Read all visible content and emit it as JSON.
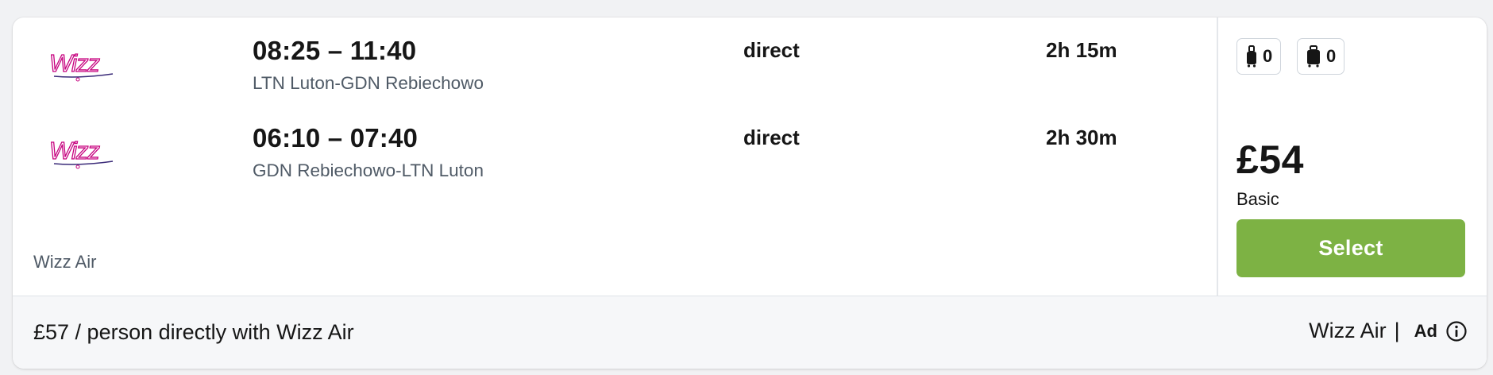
{
  "flights": [
    {
      "airline_logo_text": "Wizz",
      "times": "08:25 – 11:40",
      "route": "LTN Luton-GDN Rebiechowo",
      "stops": "direct",
      "duration": "2h 15m"
    },
    {
      "airline_logo_text": "Wizz",
      "times": "06:10 – 07:40",
      "route": "GDN Rebiechowo-LTN Luton",
      "stops": "direct",
      "duration": "2h 30m"
    }
  ],
  "airline_name": "Wizz Air",
  "baggage": {
    "cabin_bag_count": "0",
    "checked_bag_count": "0",
    "cabin_bag_icon": "cabin-bag-icon",
    "checked_bag_icon": "checked-bag-icon"
  },
  "price": {
    "amount": "£54",
    "fare_type": "Basic",
    "select_label": "Select"
  },
  "footer": {
    "offer_text": "£57 / person directly with Wizz Air",
    "airline_label": "Wizz Air",
    "separator": "|",
    "ad_label": "Ad",
    "info_icon": "info-icon"
  },
  "colors": {
    "select_button": "#7db244",
    "logo_pink": "#c6007e",
    "logo_navy": "#3a2a78",
    "muted_text": "#4f5a66"
  }
}
